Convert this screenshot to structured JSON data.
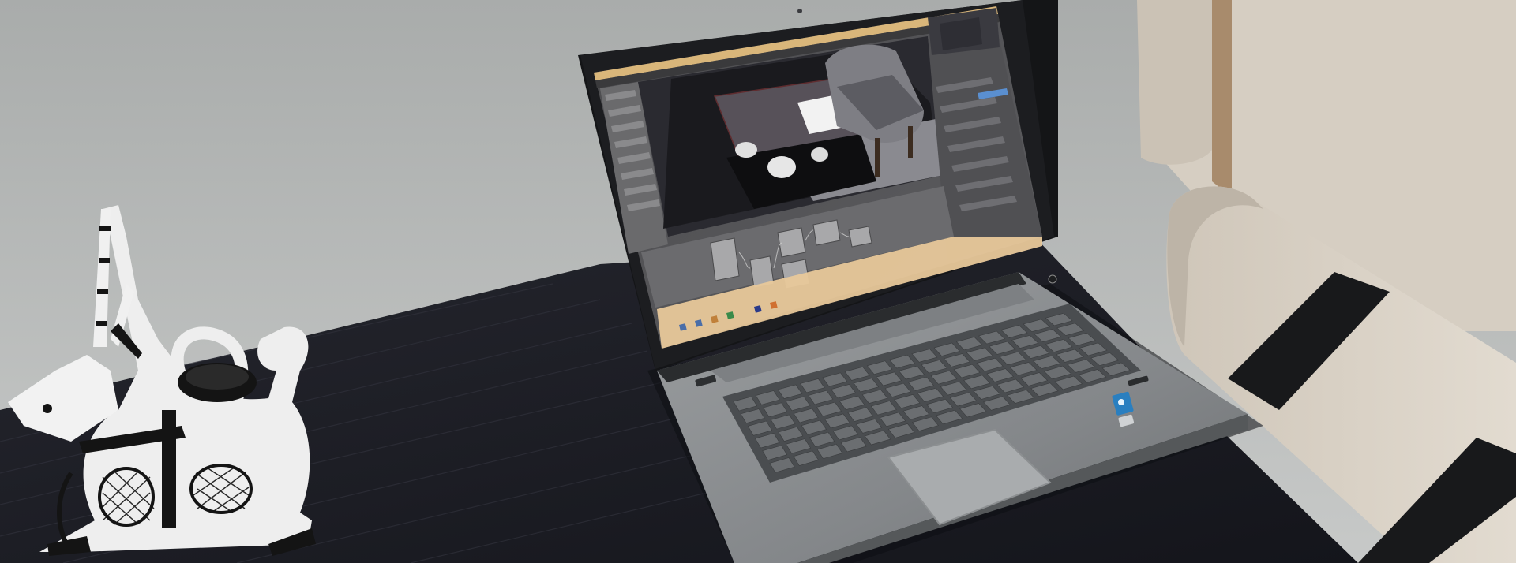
{
  "scene": {
    "description_label": "",
    "colors": {
      "wall_top": "#aeb1b0",
      "wall_bottom": "#c4c6c5",
      "desk": "#1a1b22",
      "desk_grain": "#2a2b34",
      "laptop_body": "#8d9092",
      "laptop_edge": "#6f7274",
      "bezel": "#16171a",
      "keyboard_bg": "#4a4d50",
      "key": "#6b6e71",
      "trackpad": "#a9acae",
      "blender_bg": "#555557",
      "blender_title": "#d9b67a",
      "viewport": "#1e1e22",
      "node_editor": "#6c6c6e",
      "taskbar": "#e8c89a",
      "chair": "#d8d0c4",
      "chair_shadow": "#b9b0a3",
      "strap": "#18191b",
      "figurine": "#eeeeee",
      "figurine_pattern": "#141414",
      "intel_badge": "#2a7fc0"
    },
    "icons": [
      "blender-window-icon",
      "windows-taskbar-icon",
      "intel-badge-icon",
      "power-button-icon"
    ]
  }
}
